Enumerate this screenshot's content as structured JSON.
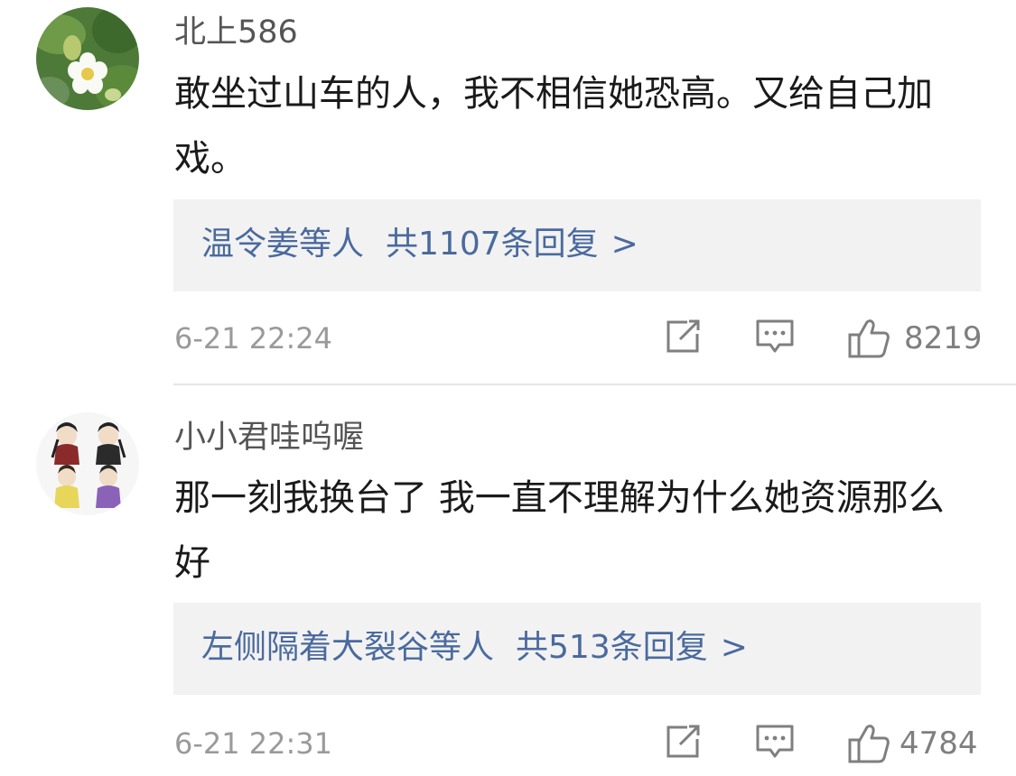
{
  "comments": [
    {
      "username": "北上586",
      "content": "敢坐过山车的人，我不相信她恐高。又给自己加戏。",
      "replies": {
        "names": "温令姜等人",
        "count": "共1107条回复",
        "chevron": ">"
      },
      "time": "6-21 22:24",
      "likes": "8219",
      "avatar_icon": "strawberry-flower-avatar"
    },
    {
      "username": "小小君哇呜喔",
      "content": "那一刻我换台了 我一直不理解为什么她资源那么好",
      "replies": {
        "names": "左侧隔着大裂谷等人",
        "count": "共513条回复",
        "chevron": ">"
      },
      "time": "6-21 22:31",
      "likes": "4784",
      "avatar_icon": "cartoon-characters-avatar"
    }
  ],
  "colors": {
    "link": "#4a6a9e",
    "reply_bg": "#f2f2f2",
    "meta": "#9a9a9a",
    "text": "#1a1a1a",
    "username": "#555555"
  }
}
